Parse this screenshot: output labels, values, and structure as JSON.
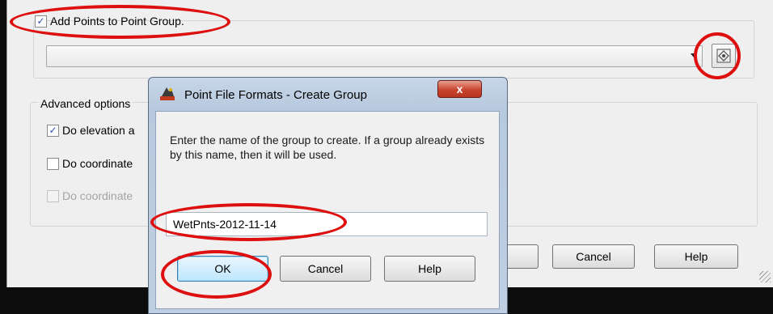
{
  "parent": {
    "add_points_label": "Add Points to Point Group.",
    "advanced_label": "Advanced options",
    "do_elevation_label": "Do elevation a",
    "do_coordinate_label_1": "Do coordinate",
    "do_coordinate_label_2": "Do coordinate",
    "cancel_label": "Cancel",
    "help_label": "Help",
    "point_group_value": ""
  },
  "dialog": {
    "title": "Point File Formats - Create Group",
    "close_glyph": "x",
    "message": "Enter the name of the group to create.  If a group already exists by this name, then it will be used.",
    "group_name_value": "WetPnts-2012-11-14",
    "ok_label": "OK",
    "cancel_label": "Cancel",
    "help_label": "Help"
  },
  "colors": {
    "annotation_red": "#dd0f0f",
    "title_bar": "#bfcfe2",
    "close_red": "#c9442e"
  },
  "icons": [
    "checkbox-checked",
    "dropdown-arrow",
    "pick-point-group-icon",
    "app-icon",
    "close-icon",
    "resize-grip"
  ]
}
